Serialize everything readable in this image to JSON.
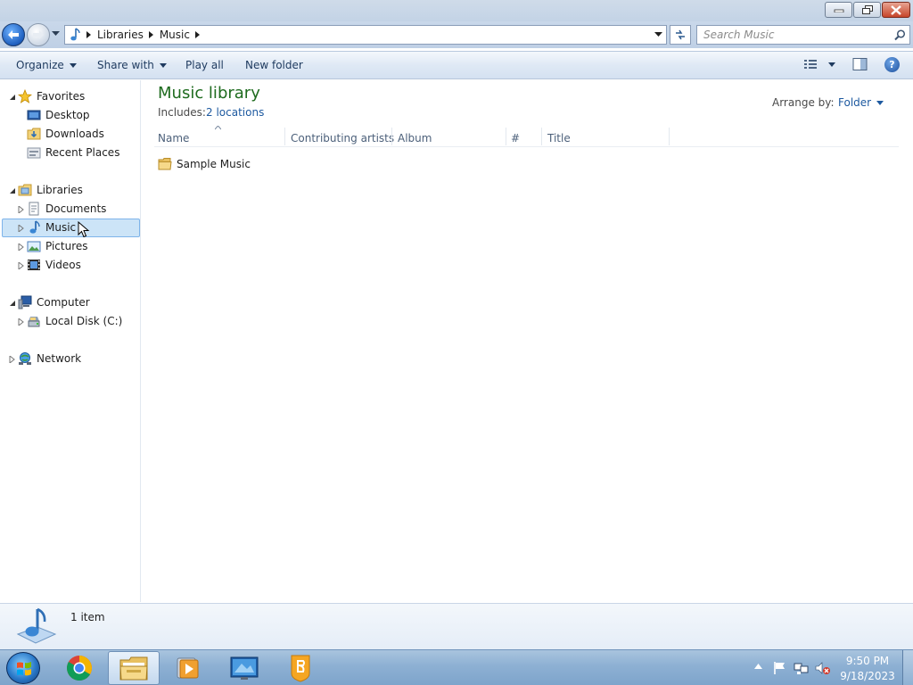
{
  "address": {
    "crumbs": [
      "Libraries",
      "Music"
    ]
  },
  "search": {
    "placeholder": "Search Music"
  },
  "toolbar": {
    "organize": "Organize",
    "share_with": "Share with",
    "play_all": "Play all",
    "new_folder": "New folder"
  },
  "nav": {
    "favorites": "Favorites",
    "desktop": "Desktop",
    "downloads": "Downloads",
    "recent_places": "Recent Places",
    "libraries": "Libraries",
    "documents": "Documents",
    "music": "Music",
    "pictures": "Pictures",
    "videos": "Videos",
    "computer": "Computer",
    "local_disk": "Local Disk (C:)",
    "network": "Network",
    "selected": "Music"
  },
  "library": {
    "title": "Music library",
    "includes_label": "Includes:",
    "includes_link": "2 locations",
    "arrange_label": "Arrange by:",
    "arrange_value": "Folder"
  },
  "columns": [
    "Name",
    "Contributing artists",
    "Album",
    "#",
    "Title"
  ],
  "items": [
    {
      "name": "Sample Music",
      "type": "folder"
    }
  ],
  "status": {
    "item_count": "1 item"
  },
  "clock": {
    "time": "9:50 PM",
    "date": "9/18/2023"
  },
  "colors": {
    "library_title": "#1e6b1e",
    "link": "#1e5aa0",
    "selection": "#cce4f7"
  },
  "icons": [
    "back-arrow-icon",
    "forward-arrow-icon",
    "music-note-icon",
    "refresh-icon",
    "search-icon",
    "star-icon",
    "folder-icon",
    "computer-icon",
    "network-icon",
    "help-icon"
  ]
}
